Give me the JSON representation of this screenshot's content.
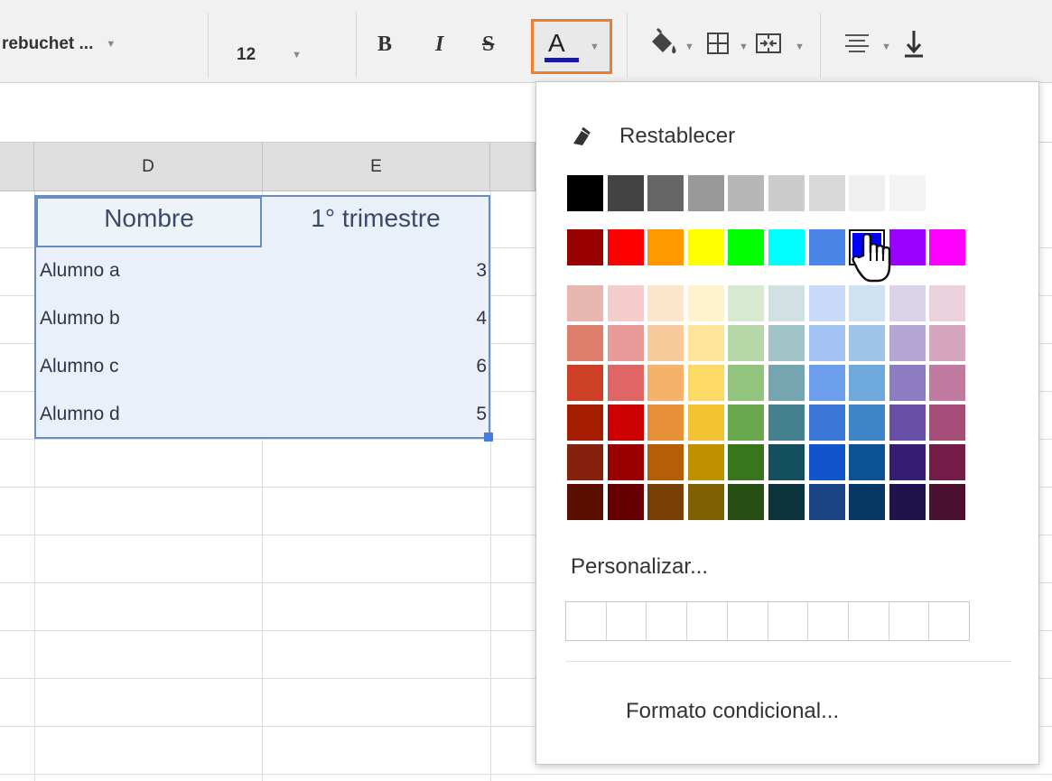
{
  "toolbar": {
    "font_name": "rebuchet ...",
    "font_size": "12",
    "bold": "B",
    "italic": "I",
    "strike": "S",
    "text_color": "A",
    "icons": [
      "fill-color-icon",
      "borders-icon",
      "merge-cells-icon",
      "align-icon",
      "vertical-align-icon"
    ]
  },
  "sheet": {
    "columns": [
      "D",
      "E"
    ],
    "header_row": [
      "Nombre",
      "1° trimestre"
    ],
    "rows": [
      {
        "name": "Alumno a",
        "value": "3"
      },
      {
        "name": "Alumno b",
        "value": "4"
      },
      {
        "name": "Alumno c",
        "value": "6"
      },
      {
        "name": "Alumno d",
        "value": "5"
      }
    ]
  },
  "palette": {
    "reset_label": "Restablecer",
    "custom_label": "Personalizar...",
    "conditional_label": "Formato condicional...",
    "selected_color": "#0000ff",
    "grays": [
      "#000000",
      "#434343",
      "#666666",
      "#999999",
      "#b7b7b7",
      "#cccccc",
      "#d9d9d9",
      "#efefef",
      "#f3f3f3",
      "#ffffff"
    ],
    "brights": [
      "#980000",
      "#ff0000",
      "#ff9900",
      "#ffff00",
      "#00ff00",
      "#00ffff",
      "#4a86e8",
      "#0000ff",
      "#9900ff",
      "#ff00ff"
    ],
    "shades": [
      [
        "#e6b8af",
        "#f4cccc",
        "#fce5cd",
        "#fff2cc",
        "#d9ead3",
        "#d0e0e3",
        "#c9daf8",
        "#cfe2f3",
        "#d9d2e9",
        "#ead1dc"
      ],
      [
        "#dd7e6b",
        "#ea9999",
        "#f9cb9c",
        "#ffe599",
        "#b6d7a8",
        "#a2c4c9",
        "#a4c2f4",
        "#9fc5e8",
        "#b4a7d6",
        "#d5a6bd"
      ],
      [
        "#cc4125",
        "#e06666",
        "#f6b26b",
        "#ffd966",
        "#93c47d",
        "#76a5af",
        "#6d9eeb",
        "#6fa8dc",
        "#8e7cc3",
        "#c27ba0"
      ],
      [
        "#a61c00",
        "#cc0000",
        "#e69138",
        "#f1c232",
        "#6aa84f",
        "#45818e",
        "#3c78d8",
        "#3d85c6",
        "#674ea7",
        "#a64d79"
      ],
      [
        "#85200c",
        "#990000",
        "#b45f06",
        "#bf9000",
        "#38761d",
        "#134f5c",
        "#1155cc",
        "#0b5394",
        "#351c75",
        "#741b47"
      ],
      [
        "#5b0f00",
        "#660000",
        "#783f04",
        "#7f6000",
        "#274e13",
        "#0c343d",
        "#1c4587",
        "#073763",
        "#20124d",
        "#4c1130"
      ]
    ]
  }
}
